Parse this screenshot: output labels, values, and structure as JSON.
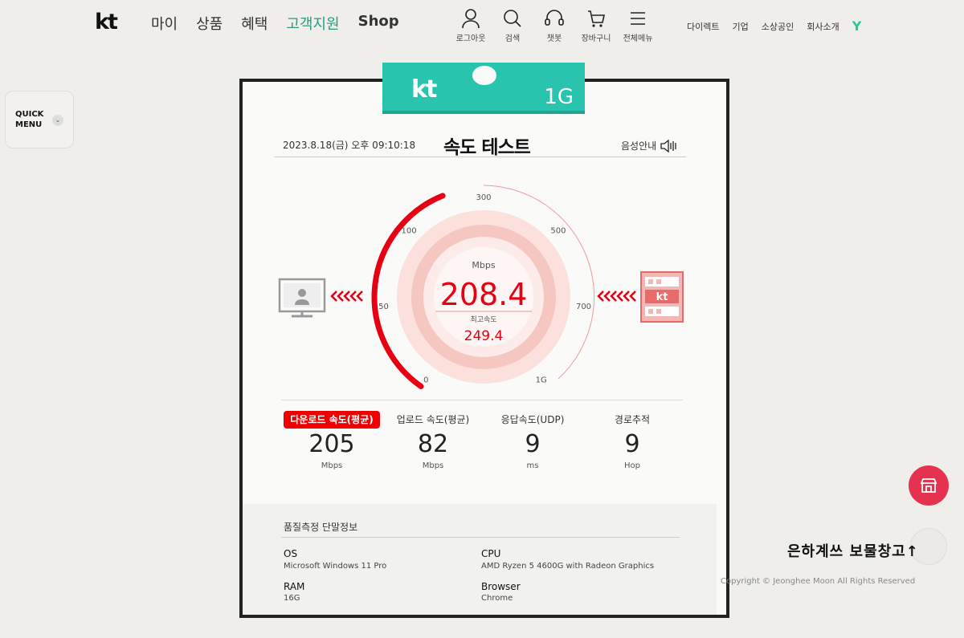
{
  "header": {
    "logo": "kt",
    "nav": [
      "마이",
      "상품",
      "혜택",
      "고객지원",
      "Shop"
    ],
    "nav_active": "고객지원",
    "util": [
      {
        "label": "로그아웃",
        "icon": "person-icon"
      },
      {
        "label": "검색",
        "icon": "search-icon"
      },
      {
        "label": "챗봇",
        "icon": "headset-icon"
      },
      {
        "label": "장바구니",
        "icon": "cart-icon"
      },
      {
        "label": "전체메뉴",
        "icon": "menu-icon"
      }
    ],
    "links": [
      "다이렉트",
      "기업",
      "소상공인",
      "회사소개"
    ],
    "links_icon": "Y"
  },
  "quick_menu": {
    "label_line1": "QUICK",
    "label_line2": "MENU",
    "chevron": "⌄"
  },
  "tag": {
    "brand": "kt",
    "plan": "1G"
  },
  "test": {
    "datetime": "2023.8.18(금) 오후 09:10:18",
    "title": "속도 테스트",
    "voice_label": "음성안내"
  },
  "gauge": {
    "unit": "Mbps",
    "current": "208.4",
    "max_label": "최고속도",
    "max_value": "249.4",
    "current_value": 208.4,
    "scale_max_mbps": 1000,
    "ticks": [
      "0",
      "50",
      "100",
      "300",
      "500",
      "700",
      "1G"
    ],
    "server_label": "kt",
    "colors": {
      "accent": "#e60012",
      "ring": "#f7c9c4",
      "ring_inner": "#fbe2df"
    }
  },
  "stats": [
    {
      "label": "다운로드 속도(평균)",
      "value": "205",
      "unit": "Mbps",
      "highlight": true
    },
    {
      "label": "업로드 속도(평균)",
      "value": "82",
      "unit": "Mbps",
      "highlight": false
    },
    {
      "label": "응답속도(UDP)",
      "value": "9",
      "unit": "ms",
      "highlight": false
    },
    {
      "label": "경로추적",
      "value": "9",
      "unit": "Hop",
      "highlight": false
    }
  ],
  "device_info": {
    "title": "품질측정 단말정보",
    "items": [
      {
        "key": "OS",
        "value": "Microsoft Windows 11 Pro"
      },
      {
        "key": "CPU",
        "value": "AMD Ryzen 5 4600G with Radeon Graphics"
      },
      {
        "key": "RAM",
        "value": "16G"
      },
      {
        "key": "Browser",
        "value": "Chrome"
      }
    ]
  },
  "watermark": "은하계쓰 보물창고",
  "copyright": "Copyright © Jeonghee Moon All Rights Reserved",
  "top_arrow": "↑"
}
